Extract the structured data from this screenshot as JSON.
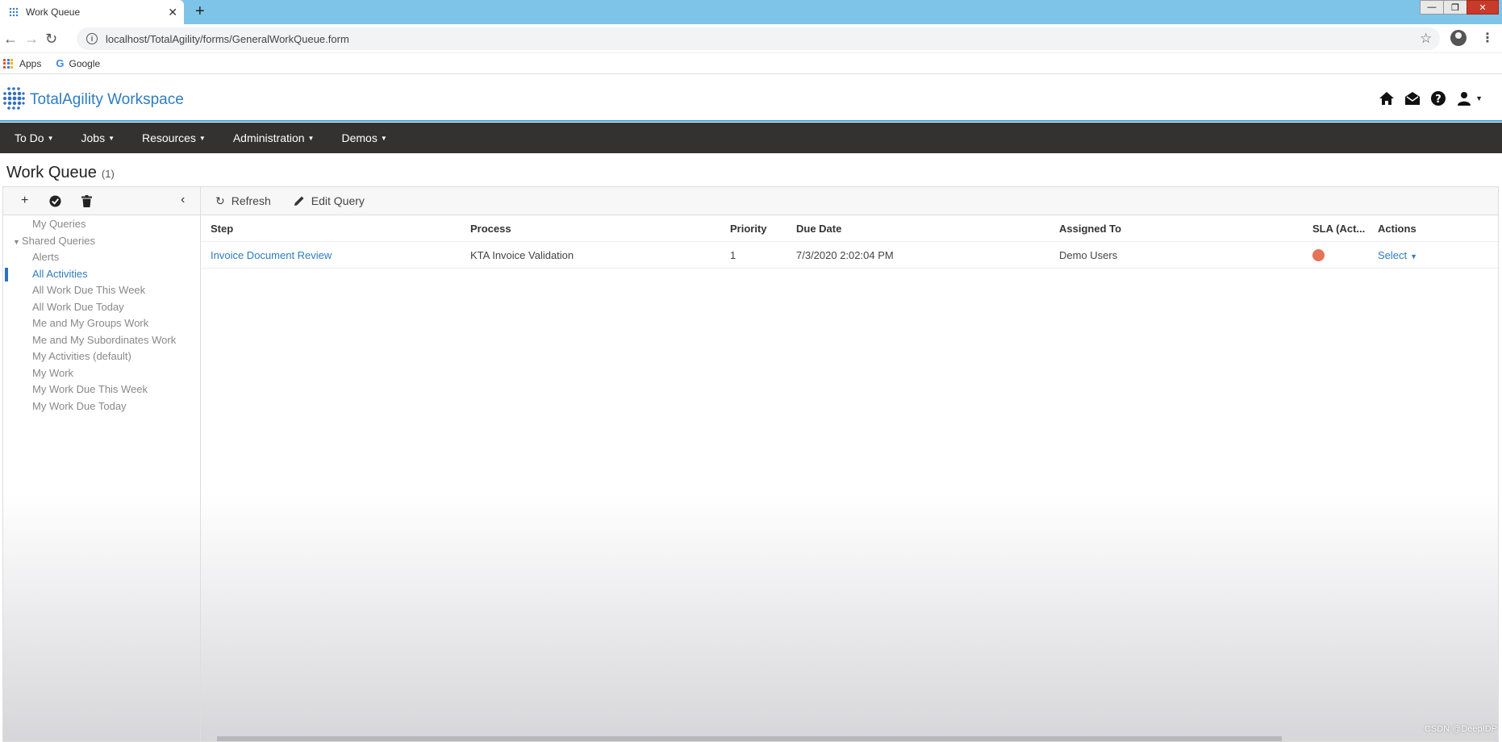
{
  "browser": {
    "tab_title": "Work Queue",
    "new_tab": "+",
    "tab_close": "✕",
    "url": "localhost/TotalAgility/forms/GeneralWorkQueue.form",
    "bookmarks": [
      {
        "label": "Apps"
      },
      {
        "label": "Google"
      }
    ]
  },
  "header": {
    "app_title": "TotalAgility Workspace"
  },
  "nav": {
    "items": [
      {
        "label": "To Do"
      },
      {
        "label": "Jobs"
      },
      {
        "label": "Resources"
      },
      {
        "label": "Administration"
      },
      {
        "label": "Demos"
      }
    ]
  },
  "page": {
    "title": "Work Queue",
    "count": "(1)"
  },
  "sidebar": {
    "items": [
      {
        "label": "My Queries",
        "type": "item"
      },
      {
        "label": "Shared Queries",
        "type": "group"
      },
      {
        "label": "Alerts",
        "type": "item"
      },
      {
        "label": "All Activities",
        "type": "item",
        "selected": true
      },
      {
        "label": "All Work Due This Week",
        "type": "item"
      },
      {
        "label": "All Work Due Today",
        "type": "item"
      },
      {
        "label": "Me and My Groups Work",
        "type": "item"
      },
      {
        "label": "Me and My Subordinates Work",
        "type": "item"
      },
      {
        "label": "My Activities (default)",
        "type": "item"
      },
      {
        "label": "My Work",
        "type": "item"
      },
      {
        "label": "My Work Due This Week",
        "type": "item"
      },
      {
        "label": "My Work Due Today",
        "type": "item"
      }
    ]
  },
  "toolbar": {
    "refresh_label": "Refresh",
    "edit_query_label": "Edit Query"
  },
  "table": {
    "columns": [
      "Step",
      "Process",
      "Priority",
      "Due Date",
      "Assigned To",
      "SLA (Act...",
      "Actions"
    ],
    "rows": [
      {
        "step": "Invoice Document Review",
        "process": "KTA Invoice Validation",
        "priority": "1",
        "due_date": "7/3/2020 2:02:04 PM",
        "assigned_to": "Demo Users",
        "sla_color": "#e57357",
        "action": "Select"
      }
    ]
  },
  "watermark": "CSDN @DeepIDP"
}
